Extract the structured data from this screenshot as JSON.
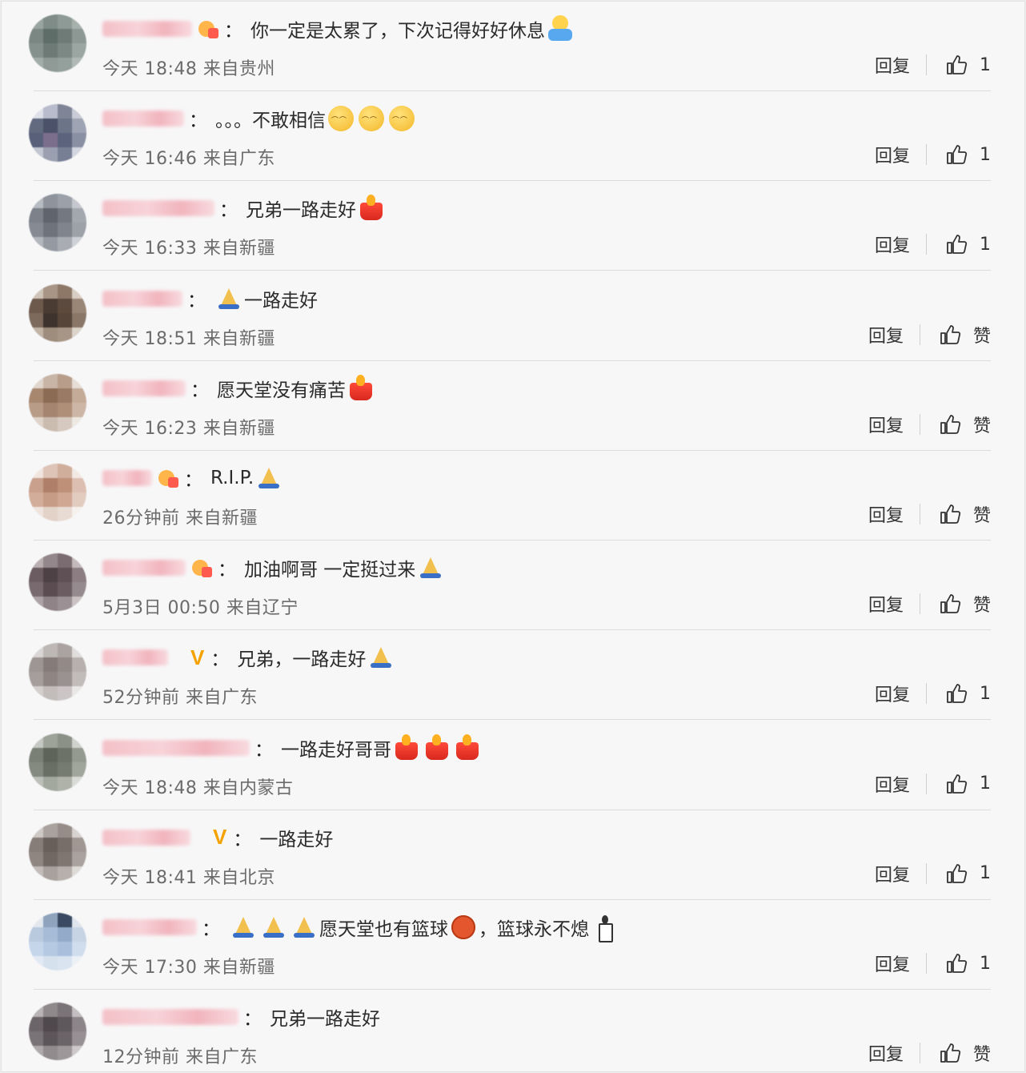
{
  "actions": {
    "reply_label": "回复",
    "like_word": "赞"
  },
  "icons": {
    "like": "thumbs-up-icon",
    "verified": "v-badge-icon",
    "badge": "heart-badge-icon"
  },
  "colors": {
    "background": "#f7f7f8",
    "name_blur": "#f3b7bf",
    "verified": "#f5a200",
    "meta": "#6b6b6b"
  },
  "comments": [
    {
      "avatar": [
        "#9aa5a0",
        "#7f8c88",
        "#8e9a95",
        "#a7b1ac",
        "#7a8783",
        "#5f6d69",
        "#6e7b77",
        "#8d9894",
        "#85918d",
        "#6d7a76",
        "#7c8884",
        "#9ba6a2",
        "#a2ada9",
        "#8f9a96",
        "#94a09b",
        "#b0b9b5"
      ],
      "nick_width": 112,
      "badges": [
        "heart"
      ],
      "segments": [
        {
          "t": "text",
          "v": "你一定是太累了，下次记得好好休息"
        },
        {
          "t": "emo",
          "v": "hug"
        }
      ],
      "meta": "今天 18:48 来自贵州",
      "like": "1"
    },
    {
      "avatar": [
        "#dfe1e8",
        "#b8bccc",
        "#7f8596",
        "#c9ccd6",
        "#626a80",
        "#4a5168",
        "#6c7488",
        "#9ea4b4",
        "#58607a",
        "#7a6e8c",
        "#5c647d",
        "#8a90a3",
        "#c2c6d1",
        "#9aa0b0",
        "#777f94",
        "#d3d6de"
      ],
      "nick_width": 102,
      "badges": [],
      "segments": [
        {
          "t": "text",
          "v": "。。。不敢相信"
        },
        {
          "t": "emo",
          "v": "sad"
        },
        {
          "t": "emo",
          "v": "sad"
        },
        {
          "t": "emo",
          "v": "sad"
        }
      ],
      "meta": "今天 16:46 来自广东",
      "like": "1"
    },
    {
      "avatar": [
        "#b7bbc2",
        "#8e939c",
        "#9ca1a9",
        "#c5c8ce",
        "#7c818a",
        "#5f646d",
        "#737881",
        "#a3a7ae",
        "#868b93",
        "#6e737c",
        "#7f848d",
        "#9da1a8",
        "#b3b7bd",
        "#959aa2",
        "#a9adb3",
        "#ced1d6"
      ],
      "nick_width": 140,
      "badges": [],
      "segments": [
        {
          "t": "text",
          "v": "兄弟一路走好"
        },
        {
          "t": "emo",
          "v": "candle"
        }
      ],
      "meta": "今天 16:33 来自新疆",
      "like": "1"
    },
    {
      "avatar": [
        "#cfc4b8",
        "#a89585",
        "#8d7868",
        "#d8cec4",
        "#6e5a4c",
        "#4b3c33",
        "#5d4a3e",
        "#9a8676",
        "#7d6a5c",
        "#3f342d",
        "#564538",
        "#8a7768",
        "#c1b3a6",
        "#9e8c7d",
        "#a79686",
        "#dcd3ca"
      ],
      "nick_width": 100,
      "badges": [],
      "segments": [
        {
          "t": "emo",
          "v": "pray"
        },
        {
          "t": "text",
          "v": " 一路走好"
        }
      ],
      "meta": "今天 18:51 来自新疆",
      "like": null
    },
    {
      "avatar": [
        "#e0d6ce",
        "#c9b5a6",
        "#b79d8a",
        "#e6ddd6",
        "#a8876f",
        "#8c6b55",
        "#9a7a65",
        "#c4ab98",
        "#b89c88",
        "#a5856f",
        "#b08f79",
        "#cdb6a5",
        "#dfd3ca",
        "#cbbcb0",
        "#d6c9bf",
        "#eee8e3"
      ],
      "nick_width": 104,
      "badges": [],
      "segments": [
        {
          "t": "text",
          "v": "愿天堂没有痛苦"
        },
        {
          "t": "emo",
          "v": "candle"
        }
      ],
      "meta": "今天 16:23 来自新疆",
      "like": null
    },
    {
      "avatar": [
        "#f0e5df",
        "#ddc4b6",
        "#cfae9c",
        "#f2e9e4",
        "#c9a08b",
        "#b07f69",
        "#bf9078",
        "#dcbfb0",
        "#d2ad99",
        "#c69c86",
        "#cfa792",
        "#e2cbbf",
        "#efe4de",
        "#e3d2c8",
        "#e8dbd3",
        "#f7f1ee"
      ],
      "nick_width": 62,
      "badges": [
        "heart"
      ],
      "segments": [
        {
          "t": "text",
          "v": "R.I.P."
        },
        {
          "t": "emo",
          "v": "pray"
        }
      ],
      "meta": "26分钟前 来自新疆",
      "like": null
    },
    {
      "avatar": [
        "#b9aeb0",
        "#94878b",
        "#7a6c70",
        "#c4babc",
        "#6b5c61",
        "#4e4145",
        "#5e5055",
        "#8b7d81",
        "#786a6f",
        "#5a4c51",
        "#6a5c61",
        "#958a8d",
        "#ada2a5",
        "#8f8387",
        "#9b9093",
        "#cbc2c4"
      ],
      "nick_width": 104,
      "badges": [
        "heart"
      ],
      "segments": [
        {
          "t": "text",
          "v": "加油啊哥 一定挺过来"
        },
        {
          "t": "emo",
          "v": "pray"
        }
      ],
      "meta": "5月3日 00:50 来自辽宁",
      "like": null
    },
    {
      "avatar": [
        "#d9d6d5",
        "#bdb7b5",
        "#aaa3a1",
        "#e0dddc",
        "#9e9694",
        "#857c7a",
        "#938a88",
        "#b7b0ae",
        "#a69e9c",
        "#8f8684",
        "#9a9290",
        "#c1bbb9",
        "#d3cfce",
        "#c2bdbb",
        "#cbc6c5",
        "#eae8e7"
      ],
      "nick_width": 82,
      "badges": [
        "v"
      ],
      "segments": [
        {
          "t": "text",
          "v": "兄弟，一路走好"
        },
        {
          "t": "emo",
          "v": "pray"
        }
      ],
      "meta": "52分钟前 来自广东",
      "like": "1"
    },
    {
      "avatar": [
        "#c6c9c3",
        "#9ea39a",
        "#8c9187",
        "#d0d3cd",
        "#7b8076",
        "#5f645a",
        "#6d7268",
        "#959a90",
        "#858a80",
        "#6a6f65",
        "#767b71",
        "#a1a69c",
        "#bcc0b8",
        "#a3a89f",
        "#aeb2a9",
        "#d9dbd6"
      ],
      "nick_width": 184,
      "badges": [],
      "segments": [
        {
          "t": "text",
          "v": "一路走好哥哥"
        },
        {
          "t": "emo",
          "v": "candle"
        },
        {
          "t": "emo",
          "v": "candle"
        },
        {
          "t": "emo",
          "v": "candle"
        }
      ],
      "meta": "今天 18:48 来自内蒙古",
      "like": "1"
    },
    {
      "avatar": [
        "#cfc9c6",
        "#aaa29e",
        "#968d89",
        "#d8d3d0",
        "#867c78",
        "#685f5b",
        "#776d69",
        "#a09793",
        "#8f8581",
        "#716864",
        "#7f7571",
        "#aaa29e",
        "#c3bcb9",
        "#a9a19d",
        "#b6afab",
        "#dedad8"
      ],
      "nick_width": 110,
      "badges": [
        "v"
      ],
      "segments": [
        {
          "t": "text",
          "v": "一路走好"
        }
      ],
      "meta": "今天 18:41 来自北京",
      "like": "1"
    },
    {
      "avatar": [
        "#e3e8ee",
        "#8fa3bd",
        "#3a4a62",
        "#dfe5ec",
        "#b9cade",
        "#a7bcd6",
        "#93abc9",
        "#c7d4e4",
        "#c6d6ea",
        "#b5c9e2",
        "#a9bfdb",
        "#d0dded",
        "#e1e9f3",
        "#d6e1ee",
        "#dae4f0",
        "#ecf1f7"
      ],
      "nick_width": 118,
      "badges": [],
      "segments": [
        {
          "t": "emo",
          "v": "pray"
        },
        {
          "t": "emo",
          "v": "pray"
        },
        {
          "t": "emo",
          "v": "pray"
        },
        {
          "t": "text",
          "v": "愿天堂也有篮球"
        },
        {
          "t": "emo",
          "v": "ball"
        },
        {
          "t": "text",
          "v": "，篮球永不熄"
        },
        {
          "t": "emo",
          "v": "candle-small"
        }
      ],
      "meta": "今天 17:30 来自新疆",
      "like": "1"
    },
    {
      "avatar": [
        "#b8b3b5",
        "#8f898c",
        "#7a7377",
        "#c3bfc1",
        "#6b6468",
        "#4f484c",
        "#5e575b",
        "#8b8488",
        "#797276",
        "#5c5559",
        "#6a6367",
        "#968f93",
        "#aea9ab",
        "#918b8e",
        "#9d979a",
        "#cdc9cb"
      ],
      "nick_width": 170,
      "badges": [],
      "segments": [
        {
          "t": "text",
          "v": "兄弟一路走好"
        }
      ],
      "meta": "12分钟前 来自广东",
      "like": null
    }
  ]
}
